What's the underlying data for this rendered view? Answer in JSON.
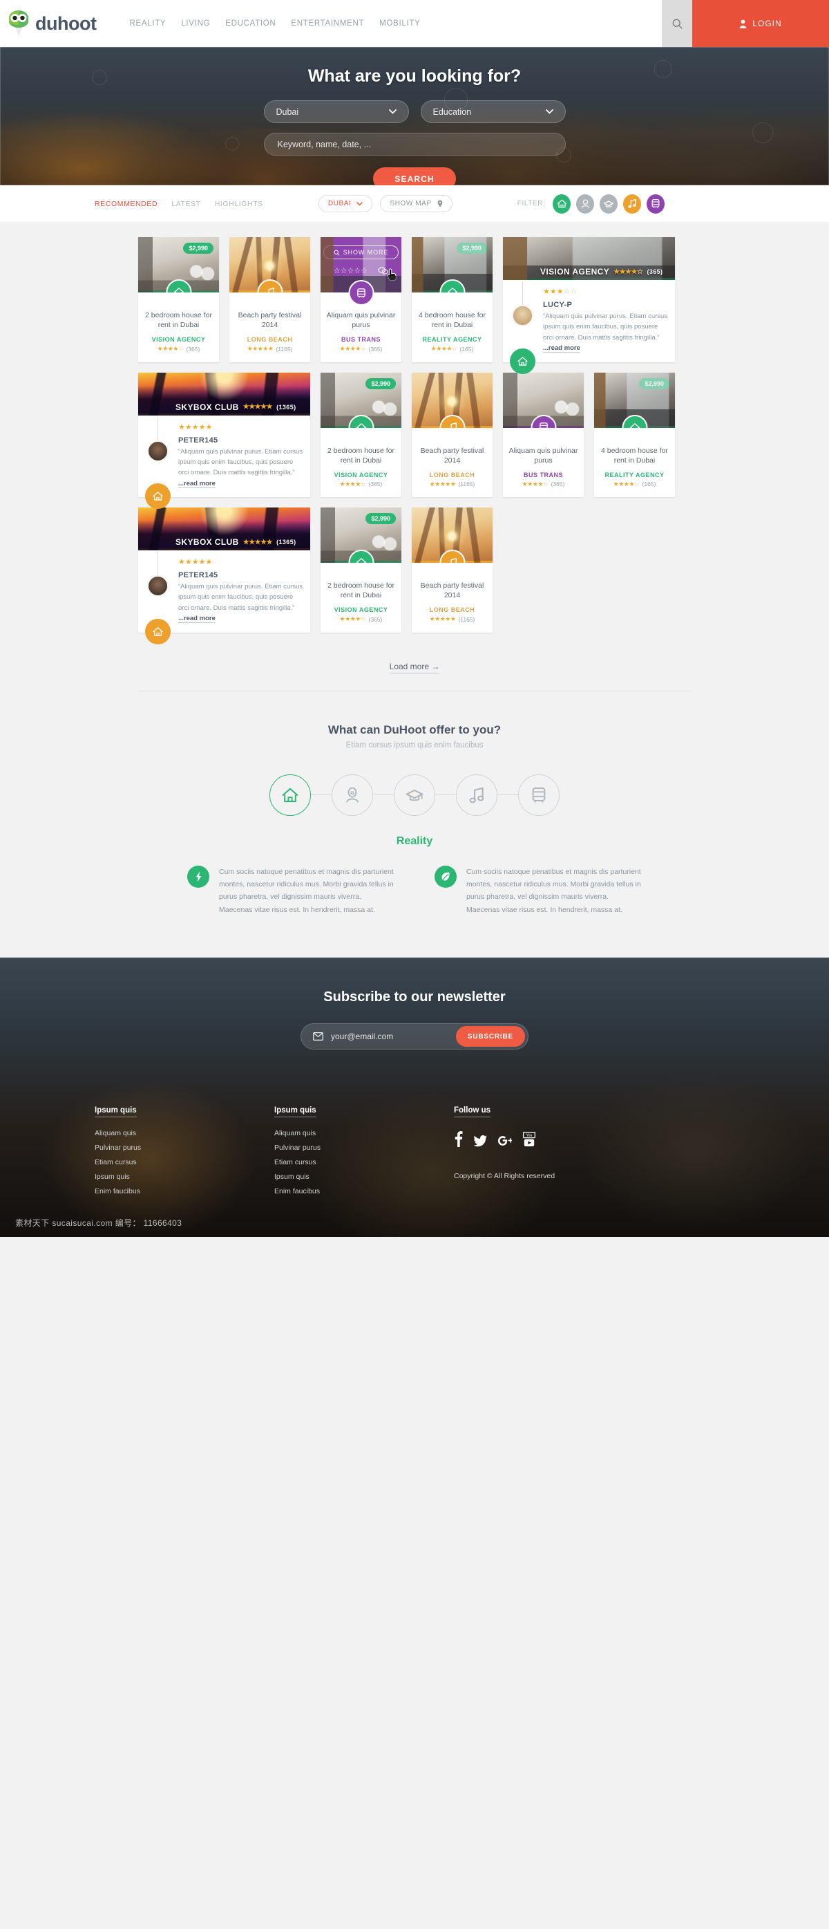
{
  "header": {
    "logo_text": "duhoot",
    "nav": [
      {
        "label": "REALITY"
      },
      {
        "label": "LIVING"
      },
      {
        "label": "EDUCATION"
      },
      {
        "label": "ENTERTAINMENT"
      },
      {
        "label": "MOBILITY"
      }
    ],
    "search_icon": "search-icon",
    "login_label": "LOGIN",
    "login_icon": "user-icon"
  },
  "hero": {
    "title": "What are you looking for?",
    "city_select": "Dubai",
    "category_select": "Education",
    "keyword_placeholder": "Keyword, name, date, ...",
    "search_button": "SEARCH"
  },
  "filterbar": {
    "tabs": [
      {
        "label": "RECOMMENDED",
        "active": true
      },
      {
        "label": "LATEST",
        "active": false
      },
      {
        "label": "HIGHLIGHTS",
        "active": false
      }
    ],
    "city_pill": "DUBAI",
    "map_pill": "SHOW MAP",
    "filter_label": "FILTER:",
    "filters": [
      {
        "name": "house-icon",
        "color": "#2bb673",
        "active": true
      },
      {
        "name": "person-icon",
        "color": "#aeb4b7",
        "active": false
      },
      {
        "name": "graduation-cap-icon",
        "color": "#aeb4b7",
        "active": false
      },
      {
        "name": "music-note-icon",
        "color": "#eda02c",
        "active": true
      },
      {
        "name": "bus-icon",
        "color": "#8e44ad",
        "active": true
      }
    ]
  },
  "cards": {
    "row1": [
      {
        "image": "img-house1",
        "price": "$2,990",
        "icon": "house-icon",
        "accent": "#2bb673",
        "title": "2 bedroom house for rent in Dubai",
        "agency": "VISION AGENCY",
        "agency_color": "#2bb673",
        "stars_filled": 4,
        "reviews": "(365)"
      },
      {
        "image": "img-beach",
        "price": "",
        "icon": "music-note-icon",
        "accent": "#eda02c",
        "title": "Beach party festival 2014",
        "agency": "LONG BEACH",
        "agency_color": "#d7a44a",
        "stars_filled": 5,
        "reviews": "(1165)"
      },
      {
        "image": "img-apart",
        "price": "",
        "icon": "bus-icon",
        "accent": "#8e44ad",
        "title": "Aliquam quis pulvinar purus",
        "agency": "BUS TRANS",
        "agency_color": "#8e44ad",
        "stars_filled": 4,
        "reviews": "(365)",
        "hovered": true,
        "show_more": "SHOW MORE"
      },
      {
        "image": "img-kitchen",
        "price": "$2,990",
        "icon": "house-icon",
        "accent": "#2bb673",
        "title": "4 bedroom house for rent in Dubai",
        "agency": "REALITY AGENCY",
        "agency_color": "#2bb673",
        "stars_filled": 4,
        "reviews": "(165)"
      }
    ],
    "row2": [
      {
        "image": "img-kitchen",
        "banner_label": "VISION AGENCY",
        "banner_stars_filled": 4,
        "banner_reviews": "(365)",
        "icon": "house-icon",
        "accent": "#2bb673",
        "avatar": "avatar-f",
        "review_stars_filled": 3,
        "user": "LUCY-P",
        "quote": "“Aliquam quis pulvinar purus. Etiam cursus ipsum quis enim faucibus, quis posuere orci ornare. Duis mattis sagittis fringilla.”",
        "read_more": "...read more"
      },
      {
        "image": "img-club",
        "banner_label": "SKYBOX CLUB",
        "banner_stars_filled": 5,
        "banner_reviews": "(1365)",
        "icon": "house-icon",
        "accent": "#eda02c",
        "avatar": "avatar-m",
        "review_stars_filled": 5,
        "user": "PETER145",
        "quote": "“Aliquam quis pulvinar purus. Etiam cursus ipsum quis enim faucibus, quis posuere orci ornare. Duis mattis sagittis fringilla.”",
        "read_more": "...read more"
      }
    ],
    "row3": [
      {
        "image": "img-house1",
        "price": "$2,990",
        "icon": "house-icon",
        "accent": "#2bb673",
        "title": "2 bedroom house for rent in Dubai",
        "agency": "VISION AGENCY",
        "agency_color": "#2bb673",
        "stars_filled": 4,
        "reviews": "(365)"
      },
      {
        "image": "img-beach",
        "price": "",
        "icon": "music-note-icon",
        "accent": "#eda02c",
        "title": "Beach party festival 2014",
        "agency": "LONG BEACH",
        "agency_color": "#d7a44a",
        "stars_filled": 5,
        "reviews": "(1165)"
      },
      {
        "image": "img-house1",
        "price": "",
        "icon": "bus-icon",
        "accent": "#8e44ad",
        "title": "Aliquam quis pulvinar purus",
        "agency": "BUS TRANS",
        "agency_color": "#8e44ad",
        "stars_filled": 4,
        "reviews": "(365)"
      },
      {
        "image": "img-kitchen",
        "price": "$2,990",
        "icon": "house-icon",
        "accent": "#2bb673",
        "title": "4 bedroom house for rent in Dubai",
        "agency": "REALITY AGENCY",
        "agency_color": "#2bb673",
        "stars_filled": 4,
        "reviews": "(165)"
      }
    ],
    "row4_testimonial": {
      "image": "img-club",
      "banner_label": "SKYBOX CLUB",
      "banner_stars_filled": 5,
      "banner_reviews": "(1365)",
      "icon": "house-icon",
      "accent": "#eda02c",
      "avatar": "avatar-m",
      "review_stars_filled": 5,
      "user": "PETER145",
      "quote": "“Aliquam quis pulvinar purus. Etiam cursus ipsum quis enim faucibus, quis posuere orci ornare. Duis mattis sagittis fringilla.”",
      "read_more": "...read more"
    },
    "row4": [
      {
        "image": "img-house1",
        "price": "$2,990",
        "icon": "house-icon",
        "accent": "#2bb673",
        "title": "2 bedroom house for rent in Dubai",
        "agency": "VISION AGENCY",
        "agency_color": "#2bb673",
        "stars_filled": 4,
        "reviews": "(365)"
      },
      {
        "image": "img-beach",
        "price": "",
        "icon": "music-note-icon",
        "accent": "#eda02c",
        "title": "Beach party festival 2014",
        "agency": "LONG BEACH",
        "agency_color": "#d7a44a",
        "stars_filled": 5,
        "reviews": "(1165)"
      }
    ],
    "load_more": "Load more →"
  },
  "offer": {
    "title": "What can DuHoot offer to you?",
    "subtitle": "Etiam cursus ipsum quis enim faucibus",
    "steps": [
      {
        "name": "house-icon",
        "active": true
      },
      {
        "name": "person-icon",
        "active": false
      },
      {
        "name": "graduation-cap-icon",
        "active": false
      },
      {
        "name": "music-note-icon",
        "active": false
      },
      {
        "name": "bus-icon",
        "active": false
      }
    ],
    "active_label": "Reality",
    "features": [
      {
        "icon": "lightning-bolt-icon",
        "text": "Cum sociis natoque penatibus et magnis dis parturient montes, nascetur ridiculus mus. Morbi gravida tellus in purus pharetra, vel dignissim mauris viverra. Maecenas vitae risus est. In hendrerit, massa at."
      },
      {
        "icon": "leaf-icon",
        "text": "Cum sociis natoque penatibus et magnis dis parturient montes, nascetur ridiculus mus. Morbi gravida tellus in purus pharetra, vel dignissim mauris viverra. Maecenas vitae risus est. In hendrerit, massa at."
      }
    ]
  },
  "newsletter": {
    "title": "Subscribe to our newsletter",
    "email_placeholder": "your@email.com",
    "mail_icon": "envelope-icon",
    "button": "SUBSCRIBE"
  },
  "footer": {
    "col1_title": "Ipsum quis",
    "col1_links": [
      "Aliquam quis",
      "Pulvinar purus",
      "Etiam cursus",
      "Ipsum quis",
      "Enim faucibus"
    ],
    "col2_title": "Ipsum quis",
    "col2_links": [
      "Aliquam quis",
      "Pulvinar purus",
      "Etiam cursus",
      "Ipsum quis",
      "Enim faucibus"
    ],
    "follow_title": "Follow us",
    "socials": [
      "facebook-icon",
      "twitter-icon",
      "google-plus-icon",
      "youtube-icon"
    ],
    "copyright": "Copyright © All Rights reserved"
  },
  "watermark": "素材天下 sucaisucai.com  编号： 11666403"
}
